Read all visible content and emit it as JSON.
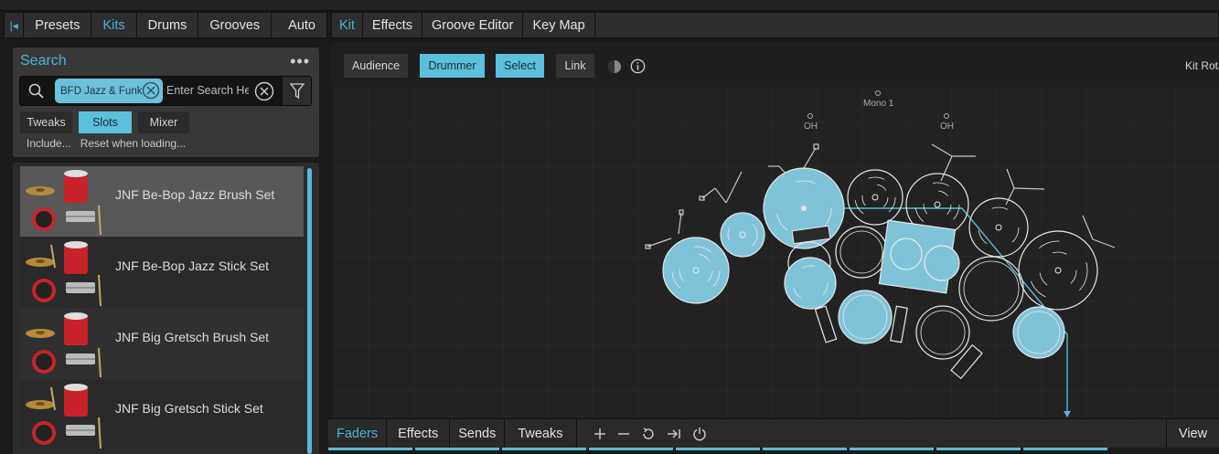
{
  "left_tabs": [
    "Presets",
    "Kits",
    "Drums",
    "Grooves",
    "Auto"
  ],
  "left_active": "Kits",
  "right_tabs": [
    "Kit",
    "Effects",
    "Groove Editor",
    "Key Map"
  ],
  "right_active": "Kit",
  "search": {
    "title": "Search",
    "chip_label": "BFD Jazz & Funk",
    "placeholder": "Enter Search He"
  },
  "subtabs": [
    "Tweaks",
    "Slots",
    "Mixer"
  ],
  "subtab_active": "Slots",
  "include_links": [
    "Include...",
    "Reset when loading..."
  ],
  "kits": [
    "JNF Be-Bop Jazz Brush Set",
    "JNF Be-Bop Jazz Stick Set",
    "JNF Big Gretsch Brush Set",
    "JNF Big Gretsch Stick Set"
  ],
  "selected_kit": "JNF Be-Bop Jazz Brush Set",
  "stage_buttons": [
    "Audience",
    "Drummer",
    "Select",
    "Link"
  ],
  "stage_buttons_active": [
    "Drummer",
    "Select"
  ],
  "kit_rotation_label": "Kit Rotation",
  "mics": {
    "mono": "Mono 1",
    "oh_left": "OH",
    "oh_right": "OH"
  },
  "bottom_tabs": [
    "Faders",
    "Effects",
    "Sends",
    "Tweaks"
  ],
  "bottom_active": "Faders",
  "bottom_view": "View",
  "colors": {
    "accent": "#4fb3d6",
    "active_button": "#5cbfdc",
    "selected_drum_fill": "#7fc3d9"
  }
}
